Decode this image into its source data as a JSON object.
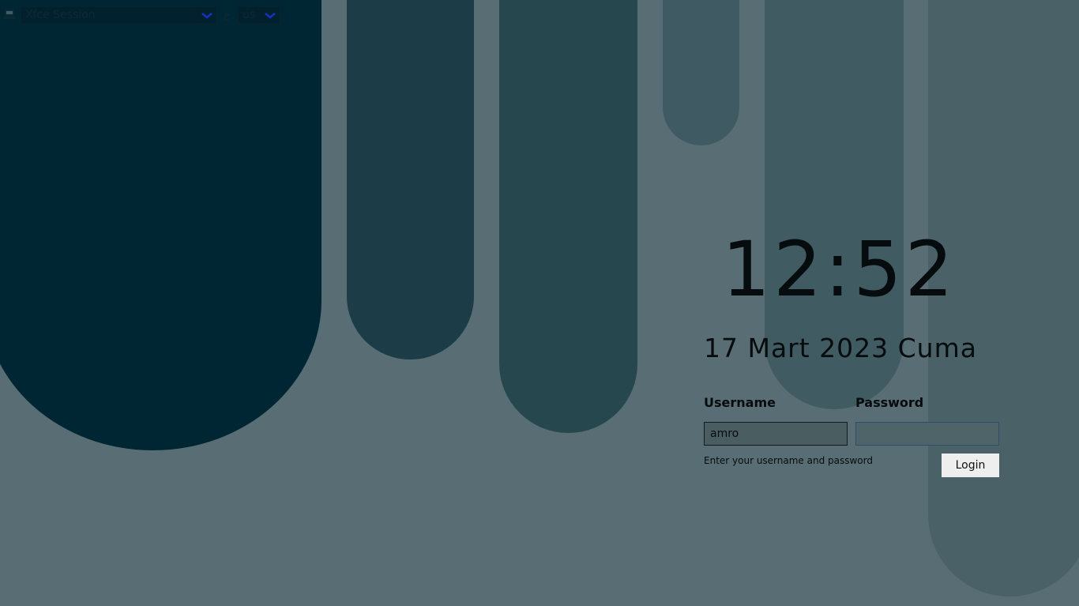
{
  "top_bar": {
    "session_icon": "computer-icon",
    "session_select": {
      "selected": "Xfce Session",
      "arrow_icon": "chevron-down-icon"
    },
    "keyboard_layout_icon": "keyboard-layout-icon",
    "keyboard_layout_glyph": "ع",
    "layout_select": {
      "selected": "us",
      "arrow_icon": "chevron-down-icon"
    }
  },
  "clock": {
    "time": "12:52",
    "date": "17 Mart 2023 Cuma"
  },
  "login_form": {
    "username_label": "Username",
    "username_value": "amro",
    "password_label": "Password",
    "password_value": "",
    "status_message": "Enter your username and password",
    "login_button": "Login"
  },
  "colors": {
    "background": "#586e74",
    "dark_pillar": "#002633",
    "accent_arrow": "#1a2fbf",
    "login_button_bg": "#eeeeee"
  }
}
